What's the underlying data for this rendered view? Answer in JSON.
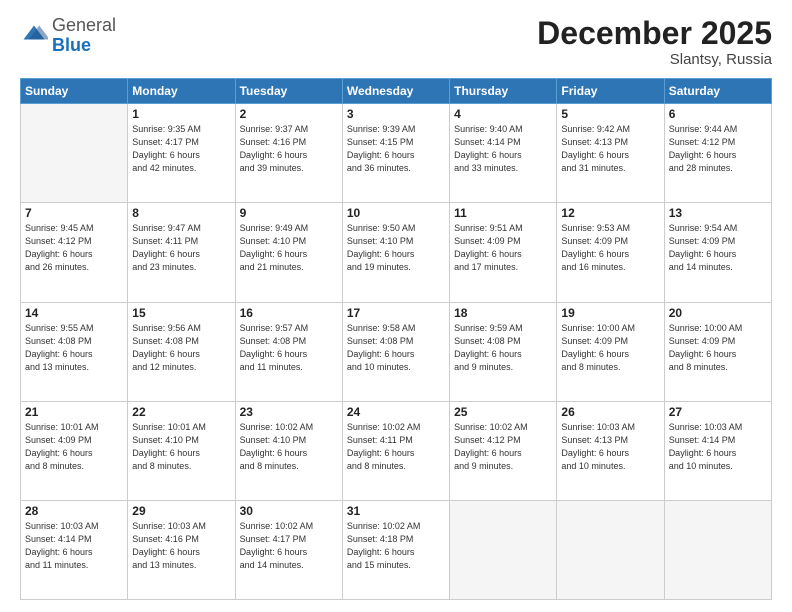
{
  "header": {
    "logo_general": "General",
    "logo_blue": "Blue",
    "month_year": "December 2025",
    "location": "Slantsy, Russia"
  },
  "weekdays": [
    "Sunday",
    "Monday",
    "Tuesday",
    "Wednesday",
    "Thursday",
    "Friday",
    "Saturday"
  ],
  "rows": [
    [
      {
        "day": "",
        "info": ""
      },
      {
        "day": "1",
        "info": "Sunrise: 9:35 AM\nSunset: 4:17 PM\nDaylight: 6 hours\nand 42 minutes."
      },
      {
        "day": "2",
        "info": "Sunrise: 9:37 AM\nSunset: 4:16 PM\nDaylight: 6 hours\nand 39 minutes."
      },
      {
        "day": "3",
        "info": "Sunrise: 9:39 AM\nSunset: 4:15 PM\nDaylight: 6 hours\nand 36 minutes."
      },
      {
        "day": "4",
        "info": "Sunrise: 9:40 AM\nSunset: 4:14 PM\nDaylight: 6 hours\nand 33 minutes."
      },
      {
        "day": "5",
        "info": "Sunrise: 9:42 AM\nSunset: 4:13 PM\nDaylight: 6 hours\nand 31 minutes."
      },
      {
        "day": "6",
        "info": "Sunrise: 9:44 AM\nSunset: 4:12 PM\nDaylight: 6 hours\nand 28 minutes."
      }
    ],
    [
      {
        "day": "7",
        "info": "Sunrise: 9:45 AM\nSunset: 4:12 PM\nDaylight: 6 hours\nand 26 minutes."
      },
      {
        "day": "8",
        "info": "Sunrise: 9:47 AM\nSunset: 4:11 PM\nDaylight: 6 hours\nand 23 minutes."
      },
      {
        "day": "9",
        "info": "Sunrise: 9:49 AM\nSunset: 4:10 PM\nDaylight: 6 hours\nand 21 minutes."
      },
      {
        "day": "10",
        "info": "Sunrise: 9:50 AM\nSunset: 4:10 PM\nDaylight: 6 hours\nand 19 minutes."
      },
      {
        "day": "11",
        "info": "Sunrise: 9:51 AM\nSunset: 4:09 PM\nDaylight: 6 hours\nand 17 minutes."
      },
      {
        "day": "12",
        "info": "Sunrise: 9:53 AM\nSunset: 4:09 PM\nDaylight: 6 hours\nand 16 minutes."
      },
      {
        "day": "13",
        "info": "Sunrise: 9:54 AM\nSunset: 4:09 PM\nDaylight: 6 hours\nand 14 minutes."
      }
    ],
    [
      {
        "day": "14",
        "info": "Sunrise: 9:55 AM\nSunset: 4:08 PM\nDaylight: 6 hours\nand 13 minutes."
      },
      {
        "day": "15",
        "info": "Sunrise: 9:56 AM\nSunset: 4:08 PM\nDaylight: 6 hours\nand 12 minutes."
      },
      {
        "day": "16",
        "info": "Sunrise: 9:57 AM\nSunset: 4:08 PM\nDaylight: 6 hours\nand 11 minutes."
      },
      {
        "day": "17",
        "info": "Sunrise: 9:58 AM\nSunset: 4:08 PM\nDaylight: 6 hours\nand 10 minutes."
      },
      {
        "day": "18",
        "info": "Sunrise: 9:59 AM\nSunset: 4:08 PM\nDaylight: 6 hours\nand 9 minutes."
      },
      {
        "day": "19",
        "info": "Sunrise: 10:00 AM\nSunset: 4:09 PM\nDaylight: 6 hours\nand 8 minutes."
      },
      {
        "day": "20",
        "info": "Sunrise: 10:00 AM\nSunset: 4:09 PM\nDaylight: 6 hours\nand 8 minutes."
      }
    ],
    [
      {
        "day": "21",
        "info": "Sunrise: 10:01 AM\nSunset: 4:09 PM\nDaylight: 6 hours\nand 8 minutes."
      },
      {
        "day": "22",
        "info": "Sunrise: 10:01 AM\nSunset: 4:10 PM\nDaylight: 6 hours\nand 8 minutes."
      },
      {
        "day": "23",
        "info": "Sunrise: 10:02 AM\nSunset: 4:10 PM\nDaylight: 6 hours\nand 8 minutes."
      },
      {
        "day": "24",
        "info": "Sunrise: 10:02 AM\nSunset: 4:11 PM\nDaylight: 6 hours\nand 8 minutes."
      },
      {
        "day": "25",
        "info": "Sunrise: 10:02 AM\nSunset: 4:12 PM\nDaylight: 6 hours\nand 9 minutes."
      },
      {
        "day": "26",
        "info": "Sunrise: 10:03 AM\nSunset: 4:13 PM\nDaylight: 6 hours\nand 10 minutes."
      },
      {
        "day": "27",
        "info": "Sunrise: 10:03 AM\nSunset: 4:14 PM\nDaylight: 6 hours\nand 10 minutes."
      }
    ],
    [
      {
        "day": "28",
        "info": "Sunrise: 10:03 AM\nSunset: 4:14 PM\nDaylight: 6 hours\nand 11 minutes."
      },
      {
        "day": "29",
        "info": "Sunrise: 10:03 AM\nSunset: 4:16 PM\nDaylight: 6 hours\nand 13 minutes."
      },
      {
        "day": "30",
        "info": "Sunrise: 10:02 AM\nSunset: 4:17 PM\nDaylight: 6 hours\nand 14 minutes."
      },
      {
        "day": "31",
        "info": "Sunrise: 10:02 AM\nSunset: 4:18 PM\nDaylight: 6 hours\nand 15 minutes."
      },
      {
        "day": "",
        "info": ""
      },
      {
        "day": "",
        "info": ""
      },
      {
        "day": "",
        "info": ""
      }
    ]
  ]
}
